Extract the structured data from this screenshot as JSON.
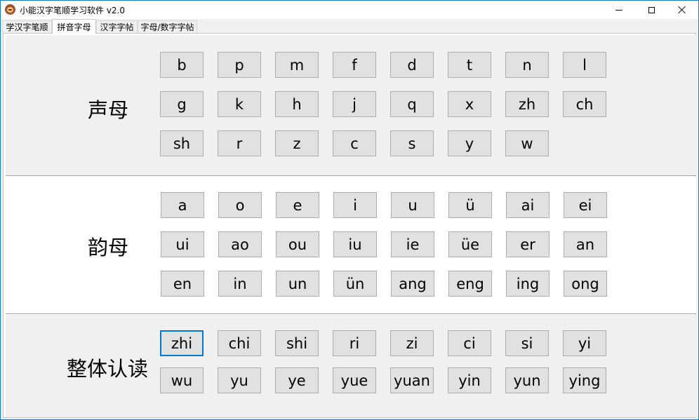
{
  "window": {
    "title": "小能汉字笔顺学习软件 v2.0"
  },
  "tabs": [
    {
      "label": "学汉字笔顺",
      "active": false
    },
    {
      "label": "拼音字母",
      "active": true
    },
    {
      "label": "汉字字帖",
      "active": false
    },
    {
      "label": "字母/数字字帖",
      "active": false
    }
  ],
  "sections": [
    {
      "label": "声母",
      "rows": [
        [
          "b",
          "p",
          "m",
          "f",
          "d",
          "t",
          "n",
          "l"
        ],
        [
          "g",
          "k",
          "h",
          "j",
          "q",
          "x",
          "zh",
          "ch"
        ],
        [
          "sh",
          "r",
          "z",
          "c",
          "s",
          "y",
          "w"
        ]
      ]
    },
    {
      "label": "韵母",
      "rows": [
        [
          "a",
          "o",
          "e",
          "i",
          "u",
          "ü",
          "ai",
          "ei"
        ],
        [
          "ui",
          "ao",
          "ou",
          "iu",
          "ie",
          "üe",
          "er",
          "an"
        ],
        [
          "en",
          "in",
          "un",
          "ün",
          "ang",
          "eng",
          "ing",
          "ong"
        ]
      ]
    },
    {
      "label": "整体认读",
      "rows": [
        [
          "zhi",
          "chi",
          "shi",
          "ri",
          "zi",
          "ci",
          "si",
          "yi"
        ],
        [
          "wu",
          "yu",
          "ye",
          "yue",
          "yuan",
          "yin",
          "yun",
          "ying"
        ]
      ]
    }
  ],
  "focused_button": "zhi",
  "colors": {
    "focus": "#0078d7",
    "button_face": "#e1e1e1",
    "window_border": "#1979ca"
  }
}
